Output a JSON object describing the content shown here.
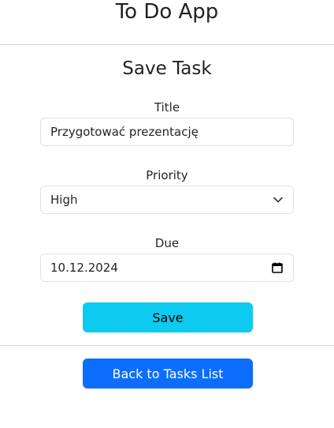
{
  "app": {
    "title": "To Do App"
  },
  "form": {
    "heading": "Save Task",
    "title_label": "Title",
    "title_value": "Przygotować prezentację",
    "priority_label": "Priority",
    "priority_value": "High",
    "due_label": "Due",
    "due_value": "10.12.2024",
    "save_label": "Save"
  },
  "nav": {
    "back_label": "Back to Tasks List"
  },
  "icons": {
    "select": "chevron-down-icon",
    "date": "calendar-icon"
  },
  "colors": {
    "save_button": "#0dcaf0",
    "back_button": "#0d6efd",
    "divider": "#cfd2d5",
    "input_border": "#dee2e6"
  }
}
